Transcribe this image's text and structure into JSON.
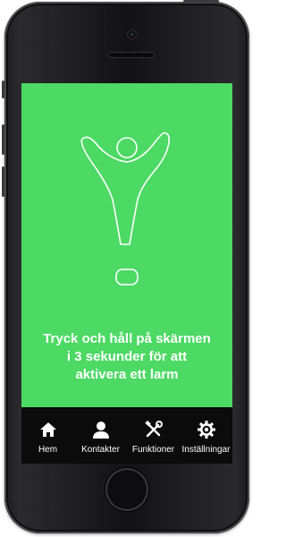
{
  "screen": {
    "background_color": "#4cd964",
    "icon": "person-exclamation-icon",
    "instruction_lines": [
      "Tryck och håll på skärmen",
      "i 3 sekunder för att",
      "aktivera ett larm"
    ]
  },
  "tabbar": {
    "items": [
      {
        "label": "Hem",
        "icon": "home-icon"
      },
      {
        "label": "Kontakter",
        "icon": "person-icon"
      },
      {
        "label": "Funktioner",
        "icon": "tools-icon"
      },
      {
        "label": "Inställningar",
        "icon": "gear-icon"
      }
    ]
  }
}
